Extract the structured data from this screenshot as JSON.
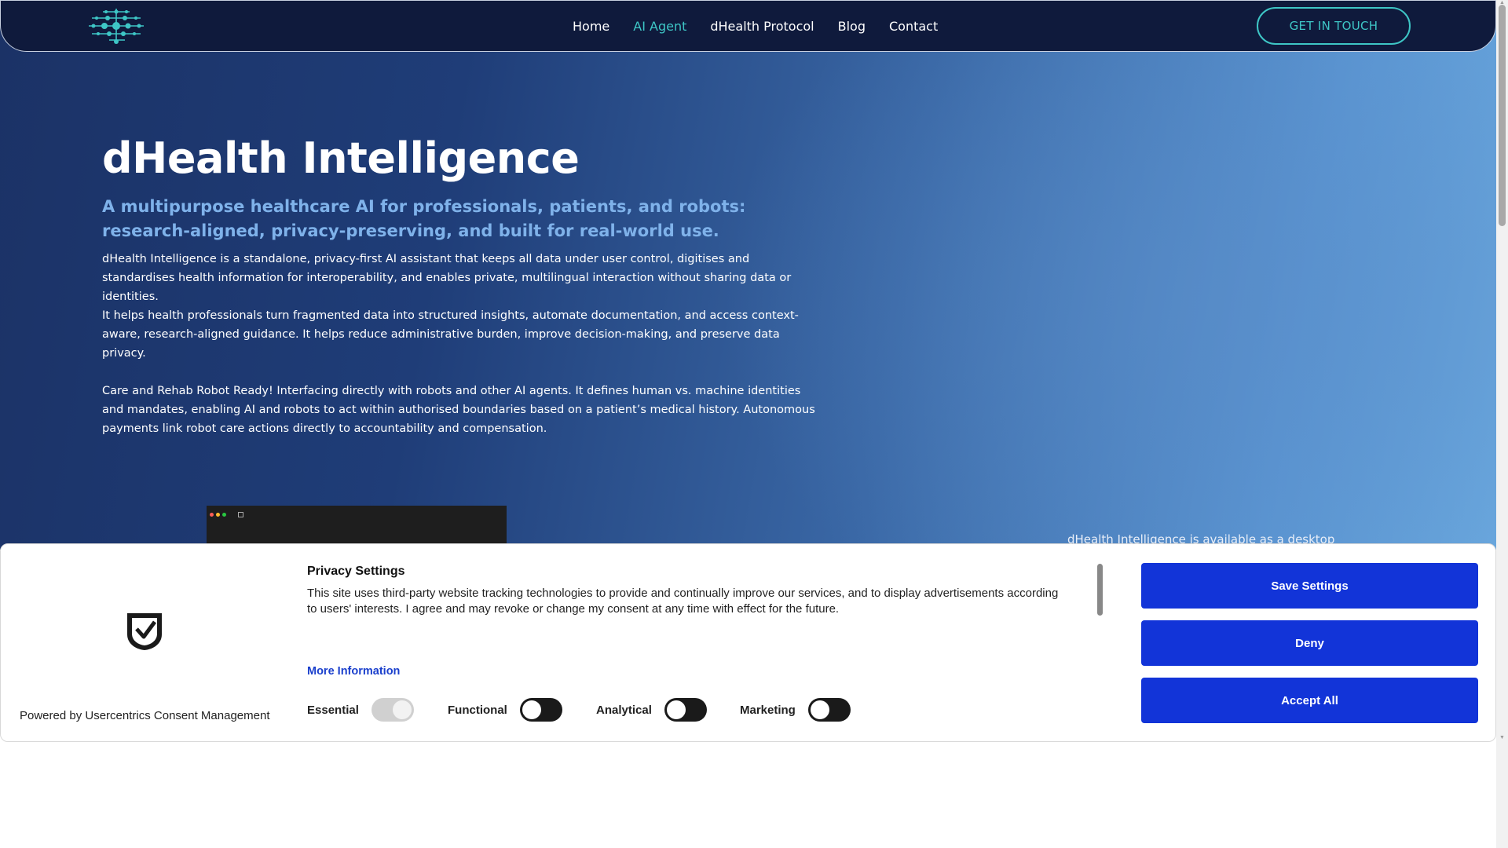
{
  "nav": {
    "links": [
      {
        "label": "Home"
      },
      {
        "label": "AI Agent"
      },
      {
        "label": "dHealth Protocol"
      },
      {
        "label": "Blog"
      },
      {
        "label": "Contact"
      }
    ],
    "cta_label": "GET IN TOUCH",
    "active_color": "#3ec6c6",
    "bar_color": "#0f1a3c"
  },
  "hero": {
    "title": "dHealth Intelligence",
    "subtitle": "A multipurpose healthcare AI for professionals, patients, and robots: research-aligned, privacy-preserving, and built for real-world use.",
    "paragraphs": [
      "dHealth Intelligence is a standalone, privacy-first AI assistant that keeps all data under user control, digitises and standardises health information for interoperability, and enables private, multilingual interaction without sharing data or identities.",
      "It helps health professionals turn fragmented data into structured insights, automate documentation, and access context-aware, research-aligned guidance. It helps reduce administrative burden, improve decision-making, and preserve data privacy.",
      "Care and Rehab Robot Ready!  Interfacing directly with robots and other AI agents. It defines human vs. machine identities and mandates, enabling AI and robots to act within authorised boundaries based on a patient’s medical history. Autonomous payments link robot care actions directly to accountability and compensation."
    ],
    "desktop_note": "dHealth Intelligence is available as a desktop",
    "subtitle_color": "#7fb2ea"
  },
  "consent": {
    "powered_by": "Powered by Usercentrics Consent Management",
    "title": "Privacy Settings",
    "description": "This site uses third-party website tracking technologies to provide and continually improve our services, and to display advertisements according to users' interests. I agree and may revoke or change my consent at any time with effect for the future.",
    "more_info": "More Information",
    "toggles": [
      {
        "label": "Essential",
        "on": true,
        "disabled": true
      },
      {
        "label": "Functional",
        "on": false,
        "disabled": false
      },
      {
        "label": "Analytical",
        "on": false,
        "disabled": false
      },
      {
        "label": "Marketing",
        "on": false,
        "disabled": false
      }
    ],
    "buttons": {
      "save": "Save Settings",
      "deny": "Deny",
      "accept": "Accept All"
    },
    "button_color": "#1234d8",
    "link_color": "#1a3fcc"
  }
}
